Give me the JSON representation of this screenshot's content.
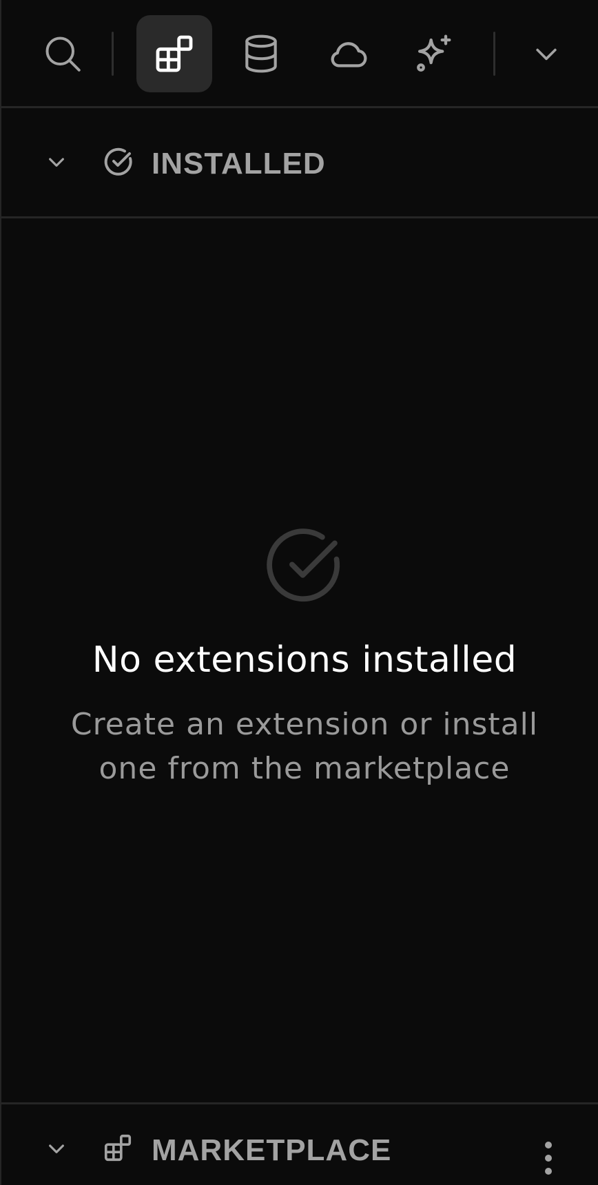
{
  "toolbar": {
    "buttons": [
      {
        "icon": "search-icon",
        "active": false
      },
      {
        "icon": "extensions-icon",
        "active": true
      },
      {
        "icon": "database-icon",
        "active": false
      },
      {
        "icon": "cloud-icon",
        "active": false
      },
      {
        "icon": "sparkles-icon",
        "active": false
      },
      {
        "icon": "chevron-down-icon",
        "active": false
      }
    ]
  },
  "sections": {
    "installed": {
      "title": "INSTALLED",
      "icon": "check-circle-icon"
    },
    "marketplace": {
      "title": "MARKETPLACE",
      "icon": "extensions-icon"
    }
  },
  "empty_state": {
    "title": "No extensions installed",
    "description": "Create an extension or install one from the marketplace",
    "icon": "check-circle-icon"
  },
  "colors": {
    "background": "#0b0b0b",
    "active_button": "#2a2a2a",
    "divider": "#262626",
    "muted_text": "#a3a3a3",
    "primary_text": "#ffffff"
  }
}
